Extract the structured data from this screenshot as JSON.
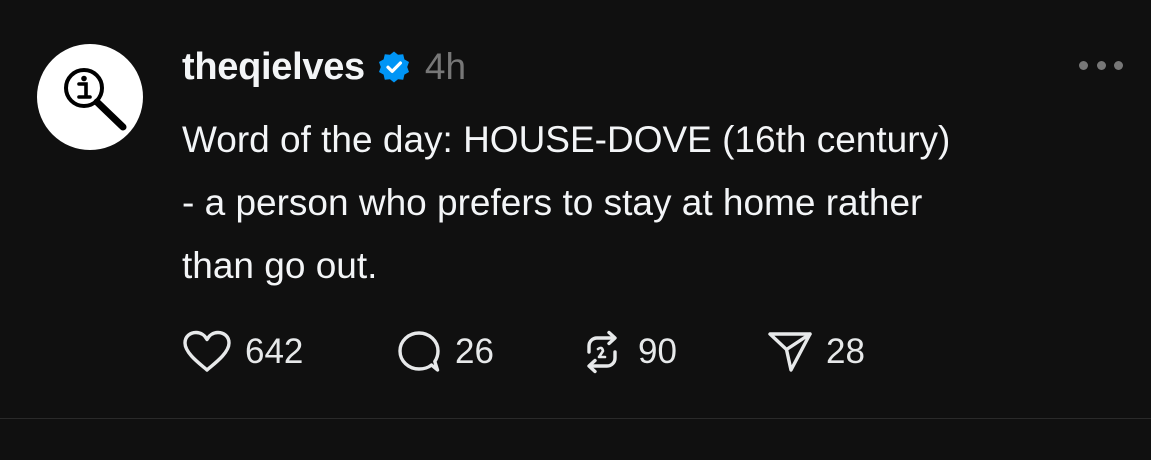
{
  "post": {
    "author": {
      "username": "theqielves",
      "verified": true,
      "avatar_icon": "info-magnifier-icon"
    },
    "timestamp": "4h",
    "text_lines": [
      "Word of the day: HOUSE-DOVE (16th century)",
      "- a person who prefers to stay at home rather",
      "than go out."
    ],
    "actions": {
      "likes": "642",
      "replies": "26",
      "reposts": "90",
      "shares": "28"
    }
  },
  "colors": {
    "background": "#101010",
    "text": "#f3f5f7",
    "muted": "#777777",
    "verified_badge": "#0095f6"
  }
}
